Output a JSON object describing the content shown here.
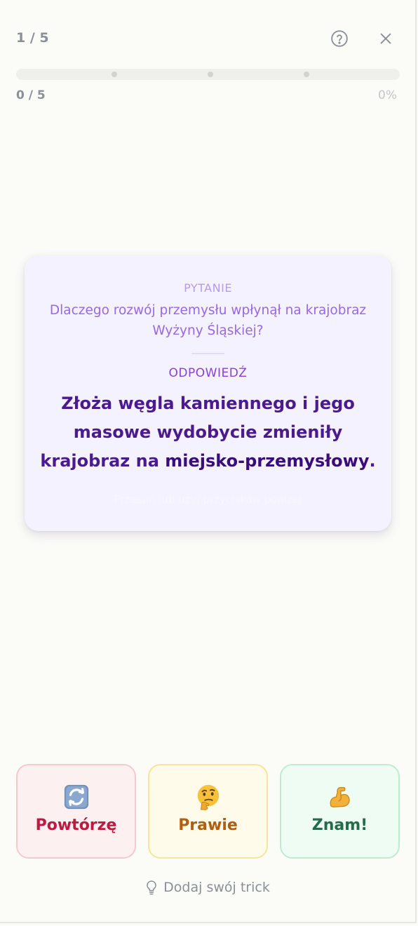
{
  "header": {
    "counter": "1 / 5",
    "help_icon": "help-circle-icon",
    "close_icon": "close-icon"
  },
  "progress": {
    "left_label": "0 / 5",
    "right_label": "0%",
    "fraction": 0,
    "fill_color": "#8b5cf6",
    "milestones": 3
  },
  "card": {
    "question_label": "PYTANIE",
    "question_text": "Dlaczego rozwój przemysłu wpłynął na krajobraz Wyżyny Śląskiej?",
    "answer_label": "ODPOWIEDŹ",
    "answer_text_before": "Złoża węgla kamiennego i jego masowe wydobycie zmieniły krajobraz na ",
    "answer_text_bold": "miejsko-przemysłowy",
    "answer_text_after": ".",
    "hint": "Przesuń lub użyj przycisków poniżej"
  },
  "buttons": {
    "repeat": {
      "label": "Powtórzę",
      "icon": "repeat-arrows-icon"
    },
    "almost": {
      "label": "Prawie",
      "icon": "thinking-face-icon"
    },
    "know": {
      "label": "Znam!",
      "icon": "flexed-biceps-icon"
    }
  },
  "footer": {
    "trick_label": "Dodaj swój trick",
    "trick_icon": "lightbulb-icon"
  },
  "colors": {
    "accent": "#8b5cf6",
    "repeat": "#c0183e",
    "almost": "#b05f10",
    "know": "#236b49"
  }
}
